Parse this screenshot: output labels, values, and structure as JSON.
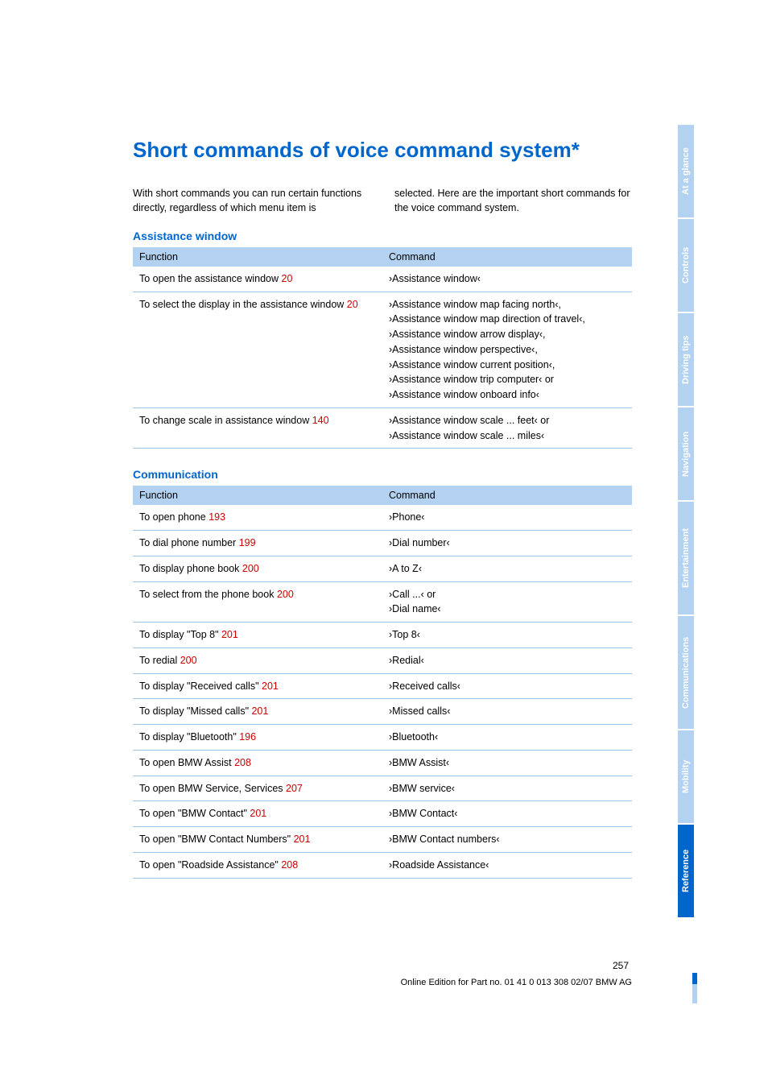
{
  "title": "Short commands of voice command system*",
  "intro_left": "With short commands you can run certain functions directly, regardless of which menu item is",
  "intro_right": "selected. Here are the important short commands for the voice command system.",
  "sections": {
    "assist": {
      "heading": "Assistance window",
      "header_func": "Function",
      "header_cmd": "Command",
      "rows": [
        {
          "func": "To open the assistance window ",
          "page": "20",
          "cmd": "›Assistance window‹"
        },
        {
          "func": "To select the display in the assistance window ",
          "page": "20",
          "cmd": "›Assistance window map facing north‹,\n›Assistance window map direction of travel‹,\n›Assistance window arrow display‹,\n›Assistance window perspective‹,\n›Assistance window current position‹,\n›Assistance window trip computer‹ or\n›Assistance window onboard info‹"
        },
        {
          "func": "To change scale in assistance window ",
          "page": "140",
          "cmd": "›Assistance window scale ... feet‹ or\n›Assistance window scale ... miles‹"
        }
      ]
    },
    "comm": {
      "heading": "Communication",
      "header_func": "Function",
      "header_cmd": "Command",
      "rows": [
        {
          "func": "To open phone ",
          "page": "193",
          "cmd": "›Phone‹"
        },
        {
          "func": "To dial phone number ",
          "page": "199",
          "cmd": "›Dial number‹"
        },
        {
          "func": "To display phone book ",
          "page": "200",
          "cmd": "›A to Z‹"
        },
        {
          "func": "To select from the phone book ",
          "page": "200",
          "cmd": "›Call ...‹ or\n›Dial name‹"
        },
        {
          "func": "To display \"Top 8\" ",
          "page": "201",
          "cmd": "›Top 8‹"
        },
        {
          "func": "To redial ",
          "page": "200",
          "cmd": "›Redial‹"
        },
        {
          "func": "To display \"Received calls\" ",
          "page": "201",
          "cmd": "›Received calls‹"
        },
        {
          "func": "To display \"Missed calls\" ",
          "page": "201",
          "cmd": "›Missed calls‹"
        },
        {
          "func": "To display \"Bluetooth\" ",
          "page": "196",
          "cmd": "›Bluetooth‹"
        },
        {
          "func": "To open BMW Assist ",
          "page": "208",
          "cmd": "›BMW Assist‹"
        },
        {
          "func": "To open BMW Service, Services ",
          "page": "207",
          "cmd": "›BMW service‹"
        },
        {
          "func": "To open \"BMW Contact\" ",
          "page": "201",
          "cmd": "›BMW Contact‹"
        },
        {
          "func": "To open \"BMW Contact Numbers\" ",
          "page": "201",
          "cmd": "›BMW Contact numbers‹"
        },
        {
          "func": "To open \"Roadside Assistance\" ",
          "page": "208",
          "cmd": "›Roadside Assistance‹"
        }
      ]
    }
  },
  "tabs": [
    "At a glance",
    "Controls",
    "Driving tips",
    "Navigation",
    "Entertainment",
    "Communications",
    "Mobility",
    "Reference"
  ],
  "active_tab": "Reference",
  "page_number": "257",
  "edition": "Online Edition for Part no. 01 41 0 013 308 02/07 BMW AG"
}
